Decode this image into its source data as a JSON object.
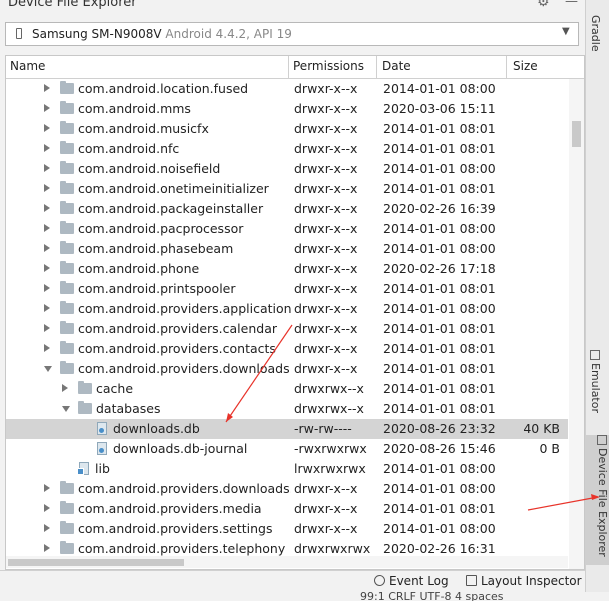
{
  "window": {
    "title": "Device File Explorer"
  },
  "device": {
    "name": "Samsung SM-N9008V",
    "version": "Android 4.4.2, API 19"
  },
  "columns": [
    "Name",
    "Permissions",
    "Date",
    "Size"
  ],
  "rows": [
    {
      "indent": 0,
      "arrow": "collapsed",
      "icon": "folder",
      "name": "com.android.location.fused",
      "perm": "drwxr-x--x",
      "date": "2014-01-01 08:00",
      "size": ""
    },
    {
      "indent": 0,
      "arrow": "collapsed",
      "icon": "folder",
      "name": "com.android.mms",
      "perm": "drwxr-x--x",
      "date": "2020-03-06 15:11",
      "size": ""
    },
    {
      "indent": 0,
      "arrow": "collapsed",
      "icon": "folder",
      "name": "com.android.musicfx",
      "perm": "drwxr-x--x",
      "date": "2014-01-01 08:01",
      "size": ""
    },
    {
      "indent": 0,
      "arrow": "collapsed",
      "icon": "folder",
      "name": "com.android.nfc",
      "perm": "drwxr-x--x",
      "date": "2014-01-01 08:01",
      "size": ""
    },
    {
      "indent": 0,
      "arrow": "collapsed",
      "icon": "folder",
      "name": "com.android.noisefield",
      "perm": "drwxr-x--x",
      "date": "2014-01-01 08:00",
      "size": ""
    },
    {
      "indent": 0,
      "arrow": "collapsed",
      "icon": "folder",
      "name": "com.android.onetimeinitializer",
      "perm": "drwxr-x--x",
      "date": "2014-01-01 08:01",
      "size": ""
    },
    {
      "indent": 0,
      "arrow": "collapsed",
      "icon": "folder",
      "name": "com.android.packageinstaller",
      "perm": "drwxr-x--x",
      "date": "2020-02-26 16:39",
      "size": ""
    },
    {
      "indent": 0,
      "arrow": "collapsed",
      "icon": "folder",
      "name": "com.android.pacprocessor",
      "perm": "drwxr-x--x",
      "date": "2014-01-01 08:00",
      "size": ""
    },
    {
      "indent": 0,
      "arrow": "collapsed",
      "icon": "folder",
      "name": "com.android.phasebeam",
      "perm": "drwxr-x--x",
      "date": "2014-01-01 08:00",
      "size": ""
    },
    {
      "indent": 0,
      "arrow": "collapsed",
      "icon": "folder",
      "name": "com.android.phone",
      "perm": "drwxr-x--x",
      "date": "2020-02-26 17:18",
      "size": ""
    },
    {
      "indent": 0,
      "arrow": "collapsed",
      "icon": "folder",
      "name": "com.android.printspooler",
      "perm": "drwxr-x--x",
      "date": "2014-01-01 08:01",
      "size": ""
    },
    {
      "indent": 0,
      "arrow": "collapsed",
      "icon": "folder",
      "name": "com.android.providers.applications",
      "perm": "drwxr-x--x",
      "date": "2014-01-01 08:00",
      "size": ""
    },
    {
      "indent": 0,
      "arrow": "collapsed",
      "icon": "folder",
      "name": "com.android.providers.calendar",
      "perm": "drwxr-x--x",
      "date": "2014-01-01 08:01",
      "size": ""
    },
    {
      "indent": 0,
      "arrow": "collapsed",
      "icon": "folder",
      "name": "com.android.providers.contacts",
      "perm": "drwxr-x--x",
      "date": "2014-01-01 08:01",
      "size": ""
    },
    {
      "indent": 0,
      "arrow": "expanded",
      "icon": "folder",
      "name": "com.android.providers.downloads",
      "perm": "drwxr-x--x",
      "date": "2014-01-01 08:01",
      "size": ""
    },
    {
      "indent": 1,
      "arrow": "collapsed",
      "icon": "folder",
      "name": "cache",
      "perm": "drwxrwx--x",
      "date": "2014-01-01 08:01",
      "size": ""
    },
    {
      "indent": 1,
      "arrow": "expanded",
      "icon": "folder",
      "name": "databases",
      "perm": "drwxrwx--x",
      "date": "2014-01-01 08:01",
      "size": ""
    },
    {
      "indent": 2,
      "arrow": "",
      "icon": "file",
      "name": "downloads.db",
      "perm": "-rw-rw----",
      "date": "2020-08-26 23:32",
      "size": "40 KB",
      "selected": true
    },
    {
      "indent": 2,
      "arrow": "",
      "icon": "file",
      "name": "downloads.db-journal",
      "perm": "-rwxrwxrwx",
      "date": "2020-08-26 15:46",
      "size": "0 B"
    },
    {
      "indent": 1,
      "arrow": "",
      "icon": "link",
      "name": "lib",
      "perm": "lrwxrwxrwx",
      "date": "2014-01-01 08:00",
      "size": ""
    },
    {
      "indent": 0,
      "arrow": "collapsed",
      "icon": "folder",
      "name": "com.android.providers.downloads.ui",
      "perm": "drwxr-x--x",
      "date": "2014-01-01 08:00",
      "size": ""
    },
    {
      "indent": 0,
      "arrow": "collapsed",
      "icon": "folder",
      "name": "com.android.providers.media",
      "perm": "drwxr-x--x",
      "date": "2014-01-01 08:01",
      "size": ""
    },
    {
      "indent": 0,
      "arrow": "collapsed",
      "icon": "folder",
      "name": "com.android.providers.settings",
      "perm": "drwxr-x--x",
      "date": "2014-01-01 08:00",
      "size": ""
    },
    {
      "indent": 0,
      "arrow": "collapsed",
      "icon": "folder",
      "name": "com.android.providers.telephony",
      "perm": "drwxrwxrwx",
      "date": "2020-02-26 16:31",
      "size": ""
    }
  ],
  "side_tabs": {
    "gradle": "Gradle",
    "emulator": "Emulator",
    "device_file_explorer": "Device File Explorer"
  },
  "bottom_tabs": {
    "event_log": "Event Log",
    "layout_inspector": "Layout Inspector"
  },
  "status": {
    "text": "99:1   CRLF   UTF-8   4 spaces"
  },
  "colors": {
    "selected_row": "#d4d4d4",
    "annotation_arrow": "#e8332a"
  }
}
